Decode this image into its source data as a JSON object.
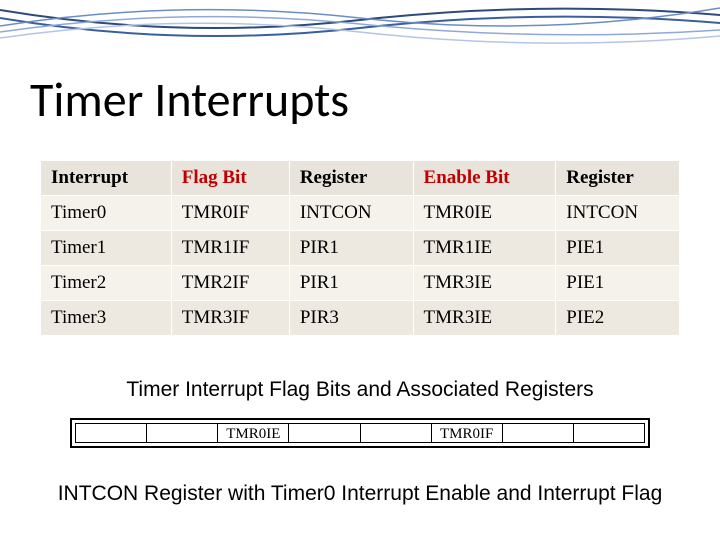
{
  "title": "Timer Interrupts",
  "table": {
    "headers": {
      "interrupt": {
        "text": "Interrupt",
        "color": "black"
      },
      "flag_bit": {
        "text": "Flag Bit",
        "color": "red"
      },
      "register1": {
        "text": "Register",
        "color": "black"
      },
      "enable_bit": {
        "text": "Enable Bit",
        "color": "red"
      },
      "register2": {
        "text": "Register",
        "color": "black"
      }
    },
    "rows": [
      {
        "interrupt": "Timer0",
        "flag_bit": "TMR0IF",
        "register1": "INTCON",
        "enable_bit": "TMR0IE",
        "register2": "INTCON"
      },
      {
        "interrupt": "Timer1",
        "flag_bit": "TMR1IF",
        "register1": "PIR1",
        "enable_bit": "TMR1IE",
        "register2": "PIE1"
      },
      {
        "interrupt": "Timer2",
        "flag_bit": "TMR2IF",
        "register1": "PIR1",
        "enable_bit": "TMR3IE",
        "register2": "PIE1"
      },
      {
        "interrupt": "Timer3",
        "flag_bit": "TMR3IF",
        "register1": "PIR3",
        "enable_bit": "TMR3IE",
        "register2": "PIE2"
      }
    ]
  },
  "caption_table": "Timer Interrupt Flag Bits and Associated Registers",
  "intcon_register": {
    "cells": [
      "",
      "",
      "TMR0IE",
      "",
      "",
      "TMR0IF",
      "",
      ""
    ]
  },
  "caption_register": "INTCON Register with Timer0 Interrupt Enable and Interrupt Flag"
}
